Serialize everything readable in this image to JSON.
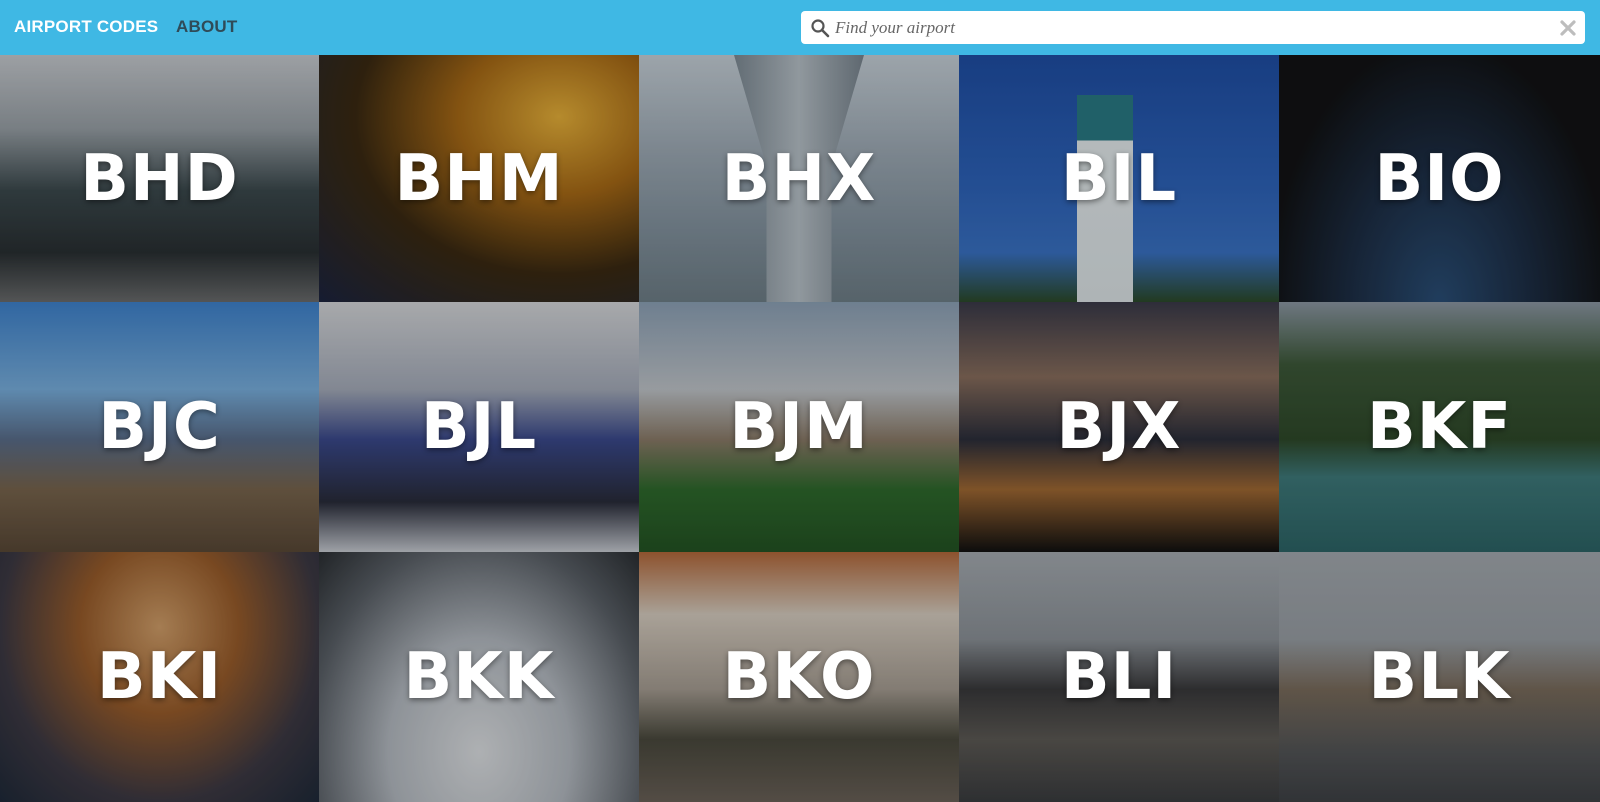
{
  "nav": {
    "brand_label": "AIRPORT CODES",
    "about_label": "ABOUT"
  },
  "search": {
    "placeholder": "Find your airport",
    "value": "",
    "search_icon": "search-icon",
    "clear_icon": "close-icon"
  },
  "colors": {
    "header_background": "#3fb8e4",
    "brand_text": "#ffffff",
    "about_text": "#2f4b58",
    "tile_code_text": "#ffffff"
  },
  "airports": [
    {
      "code": "BHD"
    },
    {
      "code": "BHM"
    },
    {
      "code": "BHX"
    },
    {
      "code": "BIL"
    },
    {
      "code": "BIO"
    },
    {
      "code": "BJC"
    },
    {
      "code": "BJL"
    },
    {
      "code": "BJM"
    },
    {
      "code": "BJX"
    },
    {
      "code": "BKF"
    },
    {
      "code": "BKI"
    },
    {
      "code": "BKK"
    },
    {
      "code": "BKO"
    },
    {
      "code": "BLI"
    },
    {
      "code": "BLK"
    }
  ]
}
